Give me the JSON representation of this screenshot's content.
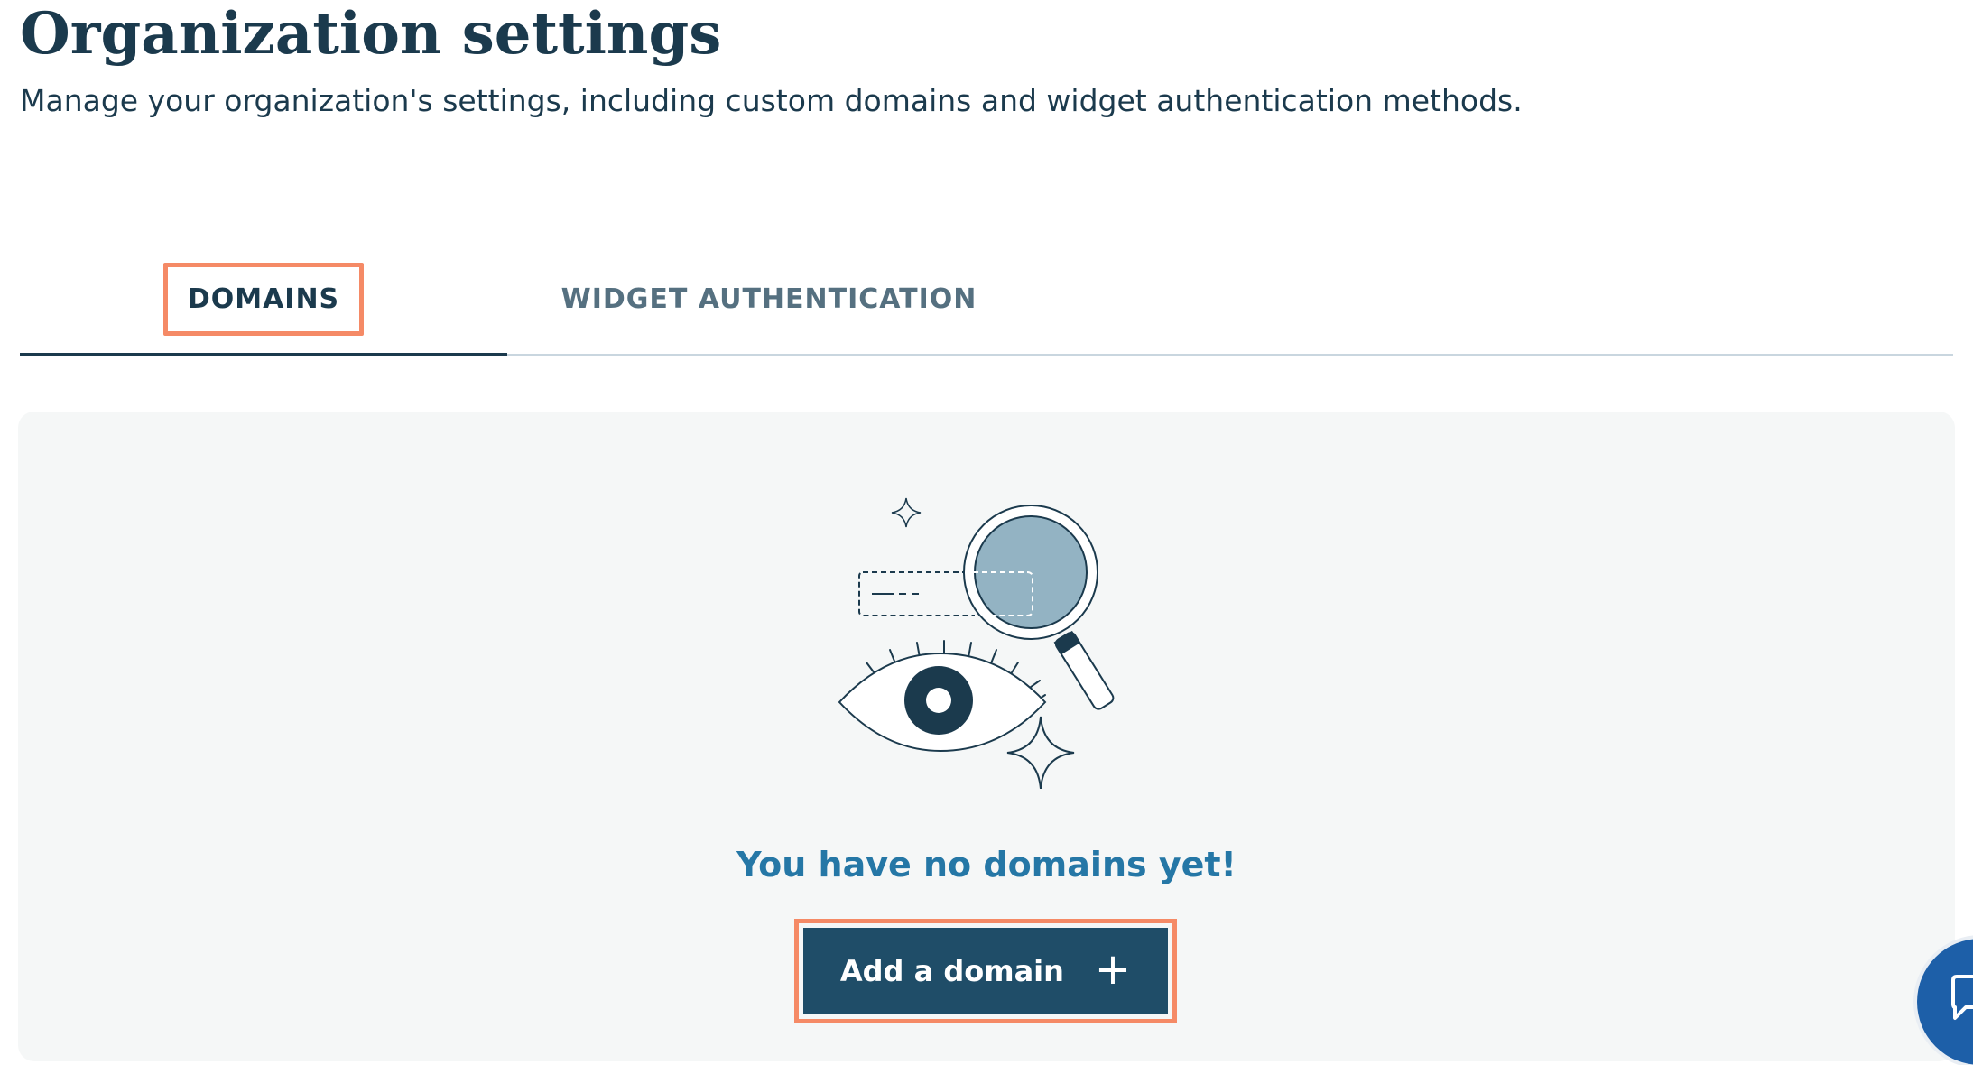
{
  "header": {
    "title": "Organization settings",
    "subtitle": "Manage your organization's settings, including custom domains and widget authentication methods."
  },
  "tabs": [
    {
      "label": "DOMAINS",
      "active": true
    },
    {
      "label": "WIDGET AUTHENTICATION",
      "active": false
    }
  ],
  "empty_state": {
    "illustration_icon": "search-magnifier-eye-icon",
    "message": "You have no domains yet!",
    "button_label": "Add a domain",
    "button_icon": "plus-icon"
  },
  "chat_button": {
    "icon": "chat-bubble-icon"
  },
  "colors": {
    "primary_dark": "#1b3a4d",
    "button": "#1f4d68",
    "message": "#2577a6",
    "highlight": "#f58a66",
    "panel_bg": "#f5f7f7",
    "chat_fab": "#1d5fa8",
    "magnifier_lens": "#93b3c3"
  }
}
